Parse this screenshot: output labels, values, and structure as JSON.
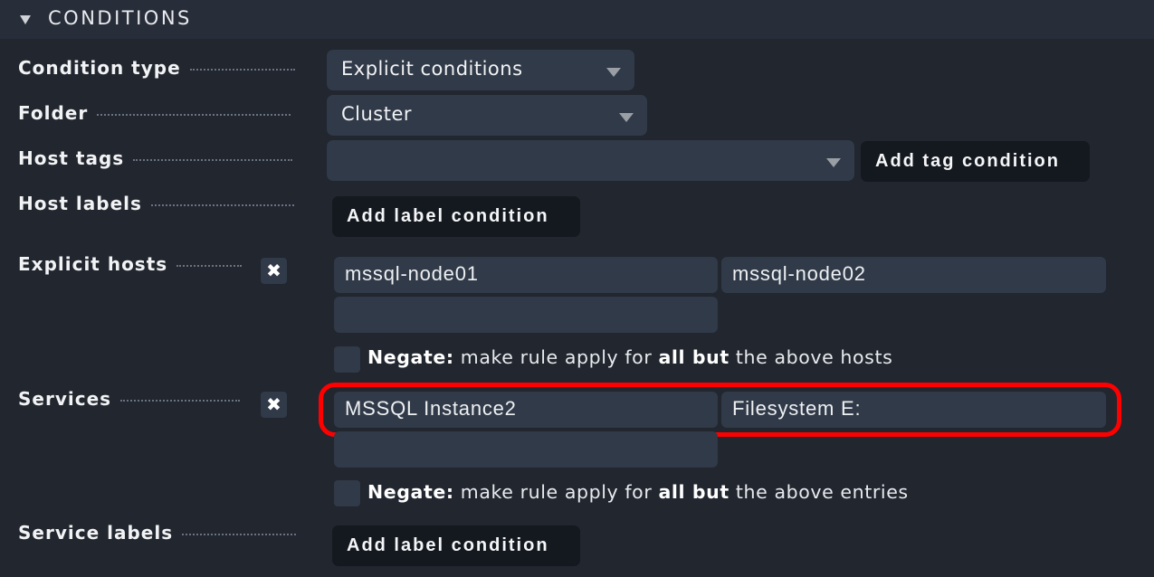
{
  "section": {
    "title": "CONDITIONS",
    "collapse_icon": "triangle-down-icon"
  },
  "condition_type": {
    "label": "Condition type",
    "value": "Explicit conditions"
  },
  "folder": {
    "label": "Folder",
    "value": "Cluster"
  },
  "host_tags": {
    "label": "Host tags",
    "value": "",
    "button": "Add tag condition"
  },
  "host_labels": {
    "label": "Host labels",
    "button": "Add label condition"
  },
  "explicit_hosts": {
    "label": "Explicit hosts",
    "remove_icon": "close-x-icon",
    "entries": [
      "mssql-node01",
      "mssql-node02",
      ""
    ],
    "negate": {
      "checked": false,
      "bold_prefix": "Negate:",
      "text1": " make rule apply for ",
      "bold_mid": "all but",
      "text2": " the above hosts"
    }
  },
  "services": {
    "label": "Services",
    "remove_icon": "close-x-icon",
    "entries": [
      "MSSQL Instance2",
      "Filesystem E:",
      ""
    ],
    "highlight_color": "#ff0000",
    "negate": {
      "checked": false,
      "bold_prefix": "Negate:",
      "text1": " make rule apply for ",
      "bold_mid": "all but",
      "text2": " the above entries"
    }
  },
  "service_labels": {
    "label": "Service labels",
    "button": "Add label condition"
  }
}
